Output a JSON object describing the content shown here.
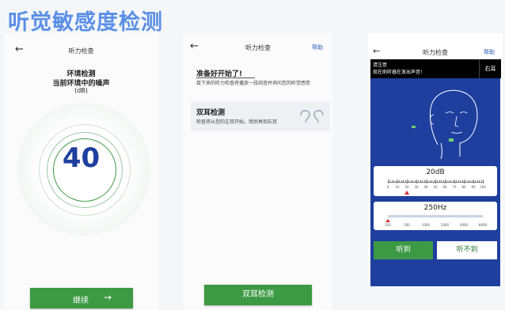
{
  "banner": {
    "title": "听觉敏感度检测"
  },
  "screen1": {
    "title": "听力检查",
    "heading1": "环境检测",
    "heading2": "当前环境中的噪声",
    "unit": "(dB)",
    "value": "40",
    "button": "继续"
  },
  "screen2": {
    "title": "听力检查",
    "help": "帮助",
    "ready_title": "准备好开始了!",
    "ready_desc": "接下来的听力检查将播放一段纯音并询问您的听觉感受",
    "card_title": "双耳检测",
    "card_desc": "检查将从您的左耳开始，然后再到右耳",
    "button": "双耳检测"
  },
  "screen3": {
    "title": "听力检查",
    "help": "帮助",
    "notice_line1": "请注意",
    "notice_line2": "现在助听器在发出声音!",
    "ear": "右耳",
    "db_value": "20dB",
    "db_ticks": [
      "0",
      "10",
      "20",
      "30",
      "40",
      "50",
      "60",
      "70",
      "80",
      "90",
      "100"
    ],
    "db_level": 0.2,
    "hz_value": "250Hz",
    "hz_ticks": [
      "250",
      "500",
      "1000",
      "2000",
      "4000",
      "8000"
    ],
    "hz_level": 0,
    "btn_heard": "听到",
    "btn_not_heard": "听不到"
  },
  "colors": {
    "accent": "#3d9a44",
    "blue": "#1e3f9e",
    "navy": "#1a3b8a",
    "banner": "#5b8fe6"
  }
}
